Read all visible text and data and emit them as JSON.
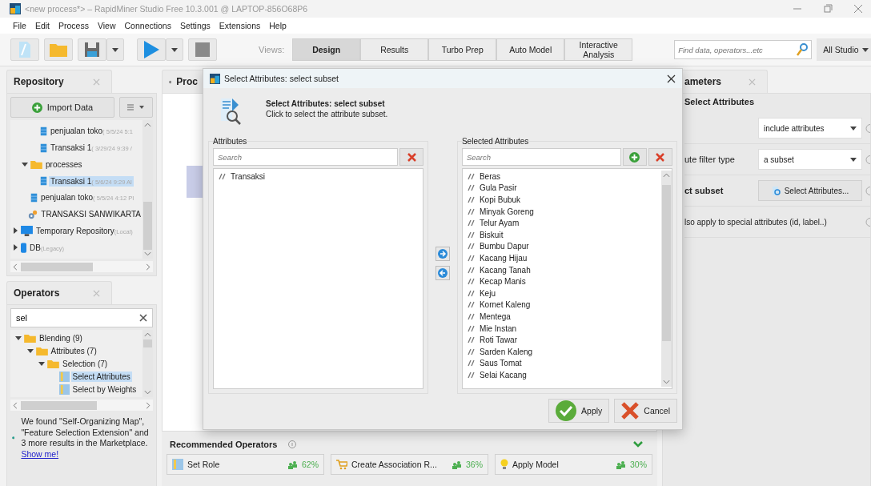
{
  "window": {
    "title": "<new process*> – RapidMiner Studio Free 10.3.001 @ LAPTOP-856O68P6"
  },
  "menu": [
    "File",
    "Edit",
    "Process",
    "View",
    "Connections",
    "Settings",
    "Extensions",
    "Help"
  ],
  "toolbar": {
    "views_label": "Views:",
    "views": [
      {
        "label": "Design",
        "selected": true
      },
      {
        "label": "Results",
        "selected": false
      },
      {
        "label": "Turbo Prep",
        "selected": false
      },
      {
        "label": "Auto Model",
        "selected": false
      },
      {
        "label": "Interactive Analysis",
        "selected": false
      }
    ],
    "search": {
      "placeholder": "Find data, operators...etc"
    },
    "scope": "All Studio"
  },
  "repository": {
    "title": "Repository",
    "import_button": "Import Data",
    "tree": [
      {
        "children": [
          {
            "children": [
              {
                "label": "penjualan toko",
                "meta": "( 5/5/24 5:1",
                "kind": "data",
                "selected": false
              },
              {
                "label": "Transaksi 1",
                "meta": "( 3/29/24 9:39 /",
                "kind": "data",
                "selected": false
              }
            ]
          },
          {
            "label": "processes",
            "kind": "folder",
            "expanded": true,
            "selected": false,
            "children": [
              {
                "label": "Transaksi 1",
                "meta": "( 5/6/24 9:29 Al",
                "kind": "data",
                "selected": true
              }
            ]
          },
          {
            "label": "penjualan toko",
            "meta": "( 5/5/24 4:12 PI",
            "kind": "data",
            "selected": false
          },
          {
            "label": "TRANSAKSI SANWIKARTA",
            "kind": "process",
            "selected": false
          }
        ]
      },
      {
        "label": "Temporary Repository",
        "meta": "(Local)",
        "kind": "monitor",
        "expanded": false,
        "selected": false
      },
      {
        "label": "DB",
        "meta": "(Legacy)",
        "kind": "db",
        "expanded": false,
        "selected": false
      }
    ]
  },
  "operators": {
    "title": "Operators",
    "search": {
      "value": "sel"
    },
    "tree": [
      {
        "label": "Blending (9)",
        "kind": "folder",
        "expanded": true,
        "selected": false,
        "children": [
          {
            "label": "Attributes (7)",
            "kind": "folder",
            "expanded": true,
            "selected": false,
            "children": [
              {
                "label": "Selection (7)",
                "kind": "folder",
                "expanded": true,
                "selected": false,
                "children": [
                  {
                    "label": "Select Attributes",
                    "kind": "operator",
                    "selected": true
                  },
                  {
                    "label": "Select by Weights",
                    "kind": "operator",
                    "selected": false
                  }
                ]
              }
            ]
          }
        ]
      }
    ],
    "marketplace": {
      "text": "We found \"Self-Organizing Map\", \"Feature Selection Extension\" and 3 more results in the Marketplace.",
      "link": "Show me!"
    }
  },
  "process": {
    "tab": "Proc"
  },
  "recommended": {
    "title": "Recommended Operators",
    "items": [
      {
        "label": "Set Role",
        "share": "62%"
      },
      {
        "label": "Create Association R...",
        "share": "36%"
      },
      {
        "label": "Apply Model",
        "share": "30%"
      }
    ]
  },
  "parameters": {
    "tab": "ameters",
    "title": "Select Attributes",
    "rows": [
      {
        "kind": "dropdown",
        "value": "include attributes"
      },
      {
        "kind": "dropdown",
        "label": "ute filter type",
        "value": "a subset"
      },
      {
        "kind": "button",
        "label": "ct subset",
        "value": "Select Attributes..."
      },
      {
        "kind": "text",
        "label": "lso apply to special attributes (id, label..)"
      }
    ]
  },
  "dialog": {
    "title": "Select Attributes: select subset",
    "heading": "Select Attributes: select subset",
    "subtitle": "Click to select the attribute subset.",
    "available": {
      "title": "Attributes",
      "placeholder": "Search",
      "items": [
        "Transaksi"
      ]
    },
    "selected": {
      "title": "Selected Attributes",
      "placeholder": "Search",
      "items": [
        "Beras",
        "Gula Pasir",
        "Kopi Bubuk",
        "Minyak Goreng",
        "Telur Ayam",
        "Biskuit",
        "Bumbu Dapur",
        "Kacang Hijau",
        "Kacang Tanah",
        "Kecap Manis",
        "Keju",
        "Kornet Kaleng",
        "Mentega",
        "Mie Instan",
        "Roti Tawar",
        "Sarden Kaleng",
        "Saus Tomat",
        "Selai Kacang"
      ]
    },
    "buttons": {
      "apply": "Apply",
      "cancel": "Cancel"
    }
  }
}
